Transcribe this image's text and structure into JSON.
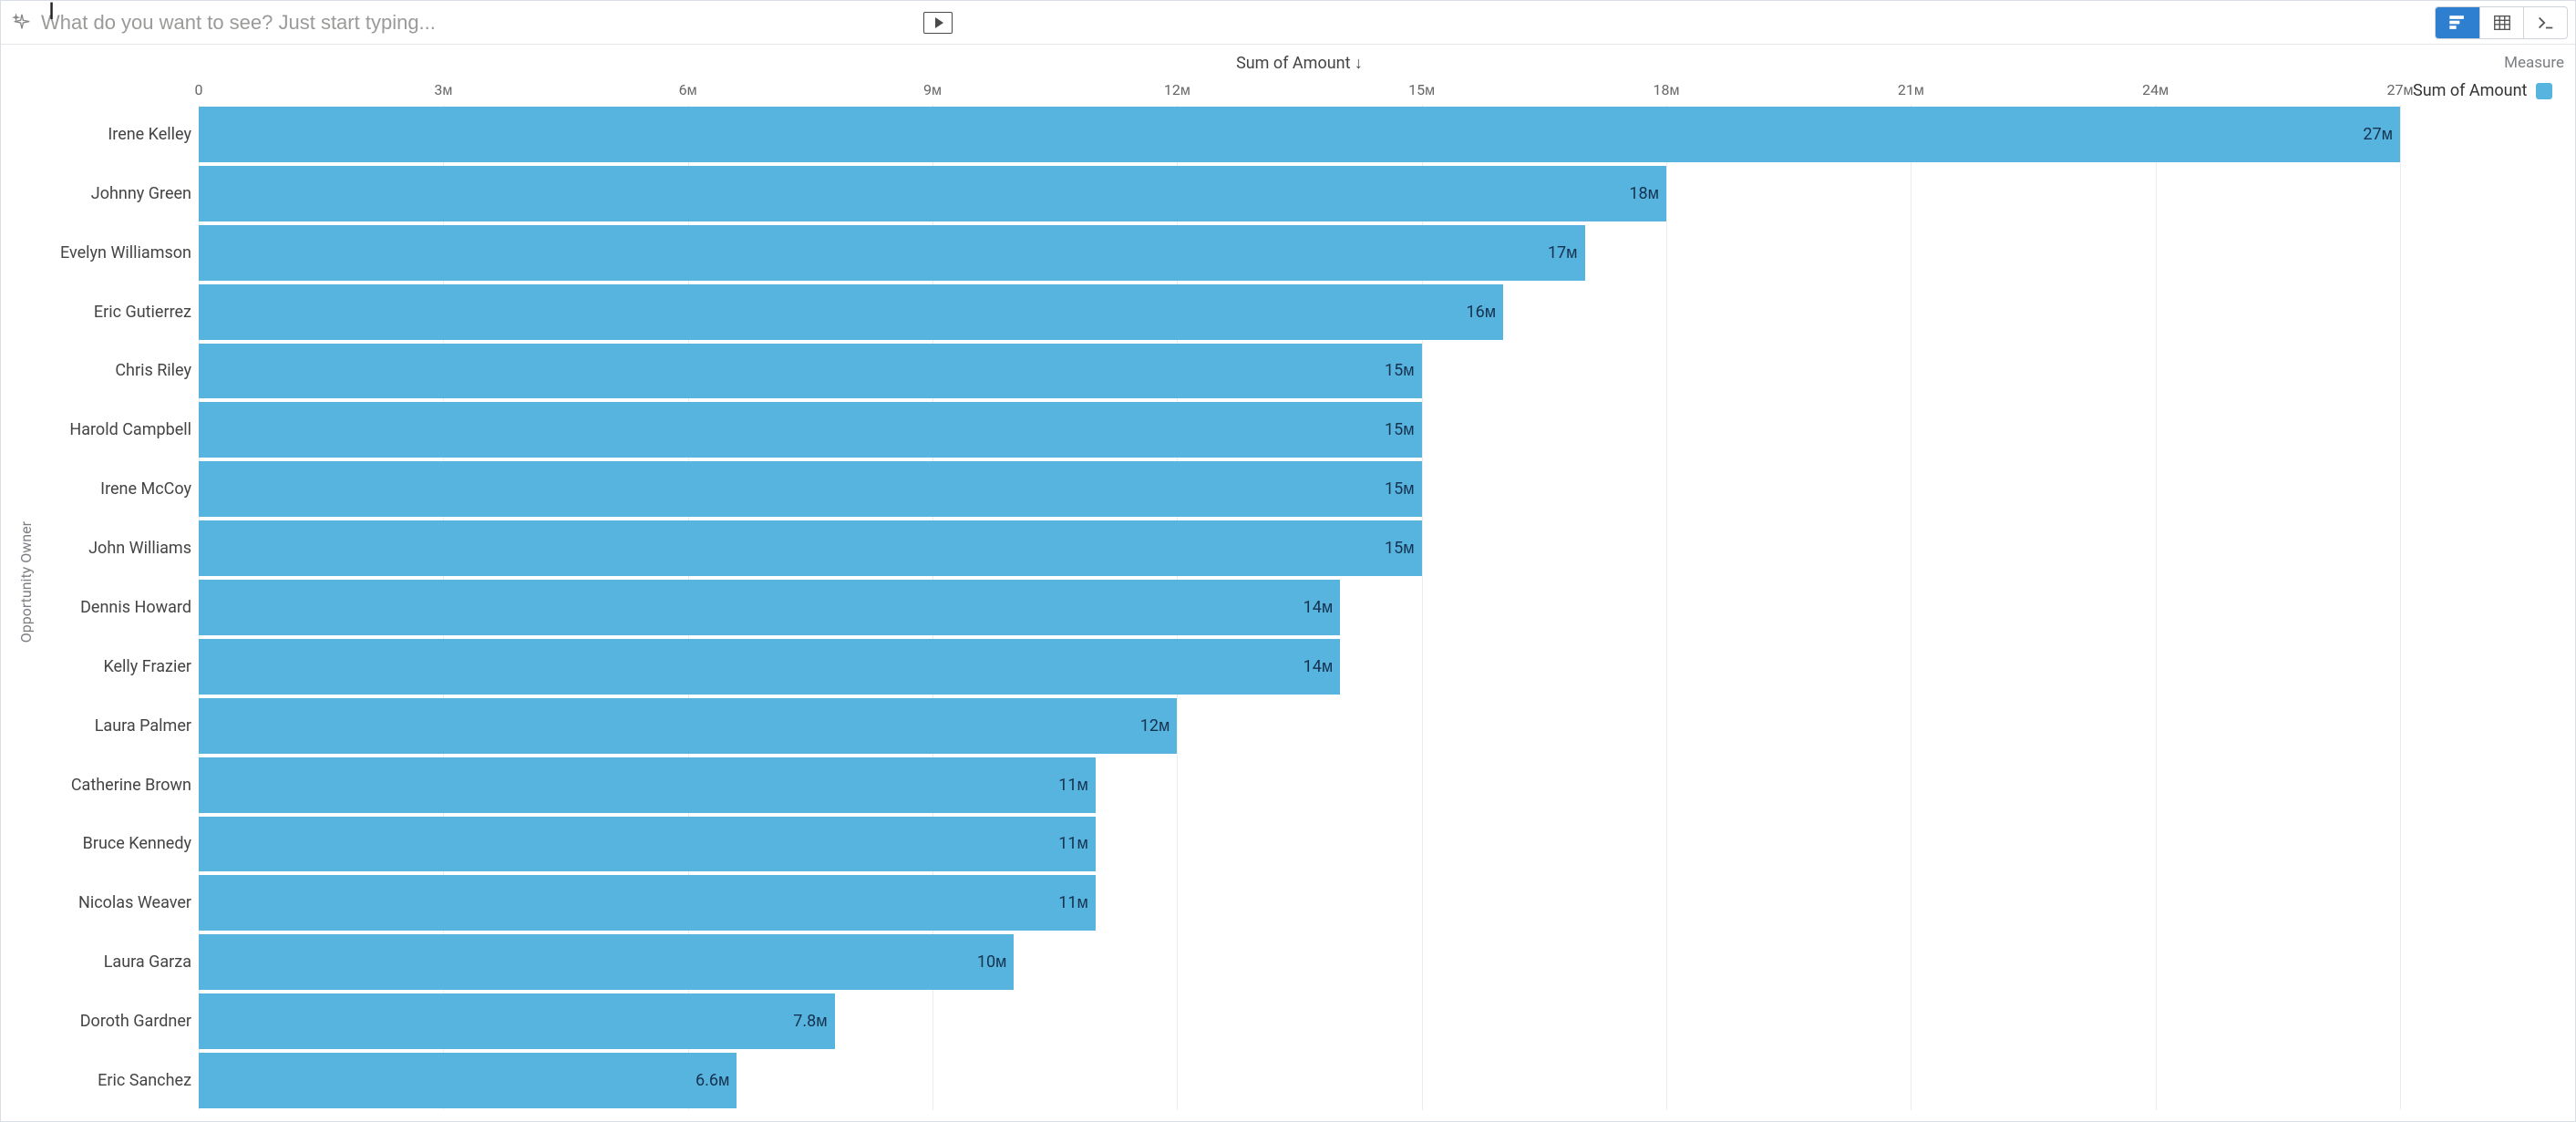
{
  "topbar": {
    "search_placeholder": "What do you want to see? Just start typing..."
  },
  "mode_buttons": {
    "chart": "chart",
    "table": "table",
    "saql": "saql"
  },
  "legend": {
    "title": "Measure",
    "series_label": "Sum of Amount"
  },
  "chart_data": {
    "type": "bar",
    "orientation": "horizontal",
    "title": "Sum of Amount ↓",
    "ylabel": "Opportunity Owner",
    "xlabel": "",
    "xlim": [
      0,
      27000000
    ],
    "x_ticks": [
      0,
      3000000,
      6000000,
      9000000,
      12000000,
      15000000,
      18000000,
      21000000,
      24000000,
      27000000
    ],
    "x_tick_labels": [
      "0",
      "3ᴍ",
      "6ᴍ",
      "9ᴍ",
      "12ᴍ",
      "15ᴍ",
      "18ᴍ",
      "21ᴍ",
      "24ᴍ",
      "27ᴍ"
    ],
    "categories": [
      "Irene Kelley",
      "Johnny Green",
      "Evelyn Williamson",
      "Eric Gutierrez",
      "Chris Riley",
      "Harold Campbell",
      "Irene McCoy",
      "John Williams",
      "Dennis Howard",
      "Kelly Frazier",
      "Laura Palmer",
      "Catherine Brown",
      "Bruce Kennedy",
      "Nicolas Weaver",
      "Laura Garza",
      "Doroth Gardner",
      "Eric Sanchez"
    ],
    "values": [
      27000000,
      18000000,
      17000000,
      16000000,
      15000000,
      15000000,
      15000000,
      15000000,
      14000000,
      14000000,
      12000000,
      11000000,
      11000000,
      11000000,
      10000000,
      7800000,
      6600000
    ],
    "value_labels": [
      "27ᴍ",
      "18ᴍ",
      "17ᴍ",
      "16ᴍ",
      "15ᴍ",
      "15ᴍ",
      "15ᴍ",
      "15ᴍ",
      "14ᴍ",
      "14ᴍ",
      "12ᴍ",
      "11ᴍ",
      "11ᴍ",
      "11ᴍ",
      "10ᴍ",
      "7.8ᴍ",
      "6.6ᴍ"
    ],
    "series": [
      {
        "name": "Sum of Amount",
        "color": "#57b4df"
      }
    ]
  }
}
